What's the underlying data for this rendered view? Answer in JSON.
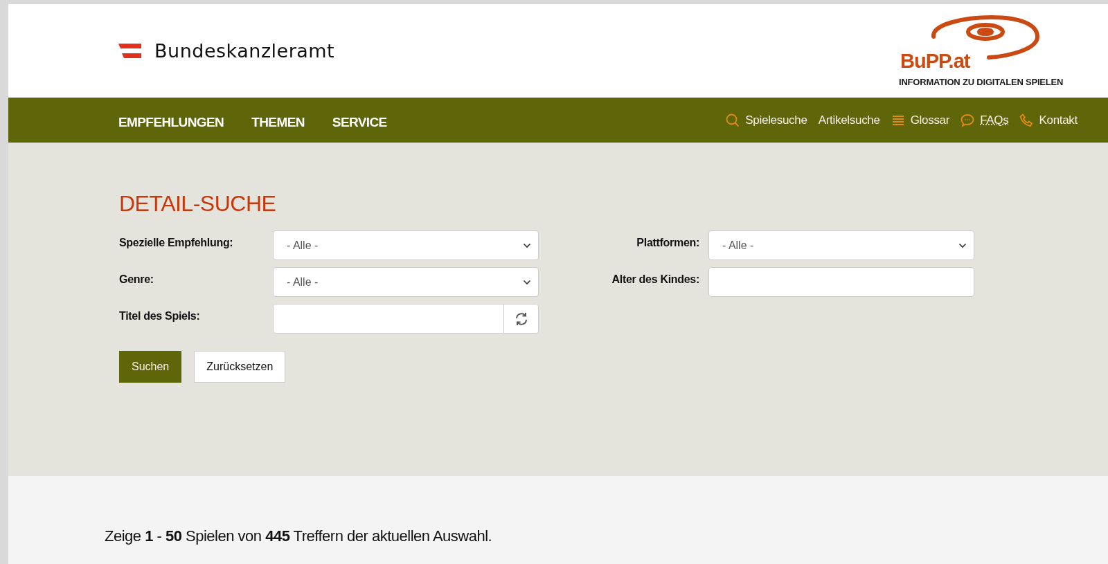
{
  "header": {
    "brand": "Bundeskanzleramt",
    "logo_text": "BuPP.at",
    "logo_tagline": "INFORMATION ZU DIGITALEN SPIELEN"
  },
  "main_nav": [
    {
      "label": "EMPFEHLUNGEN"
    },
    {
      "label": "THEMEN"
    },
    {
      "label": "SERVICE"
    }
  ],
  "service_nav": [
    {
      "label": "Spielesuche",
      "kind": "search",
      "underlined": false
    },
    {
      "label": "Artikelsuche",
      "kind": "plain",
      "underlined": false
    },
    {
      "label": "Glossar",
      "kind": "list",
      "underlined": false
    },
    {
      "label": "FAQs",
      "kind": "chat",
      "underlined": true
    },
    {
      "label": "Kontakt",
      "kind": "phone",
      "underlined": false
    }
  ],
  "search_form": {
    "title": "DETAIL-SUCHE",
    "left_fields": [
      {
        "label": "Spezielle Empfehlung:",
        "kind": "select",
        "value": "- Alle -"
      },
      {
        "label": "Genre:",
        "kind": "select",
        "value": "- Alle -"
      },
      {
        "label": "Titel des Spiels:",
        "kind": "text-refresh"
      }
    ],
    "right_fields": [
      {
        "label": "Plattformen:",
        "kind": "select",
        "value": "- Alle -"
      },
      {
        "label": "Alter des Kindes:",
        "kind": "text"
      }
    ],
    "buttons": [
      {
        "label": "Suchen",
        "kind": "primary"
      },
      {
        "label": "Zurücksetzen",
        "kind": "secondary"
      }
    ]
  },
  "results": {
    "summary": "Zeige **1** - **50** Spielen von **445** Treffern der aktuellen Auswahl."
  }
}
